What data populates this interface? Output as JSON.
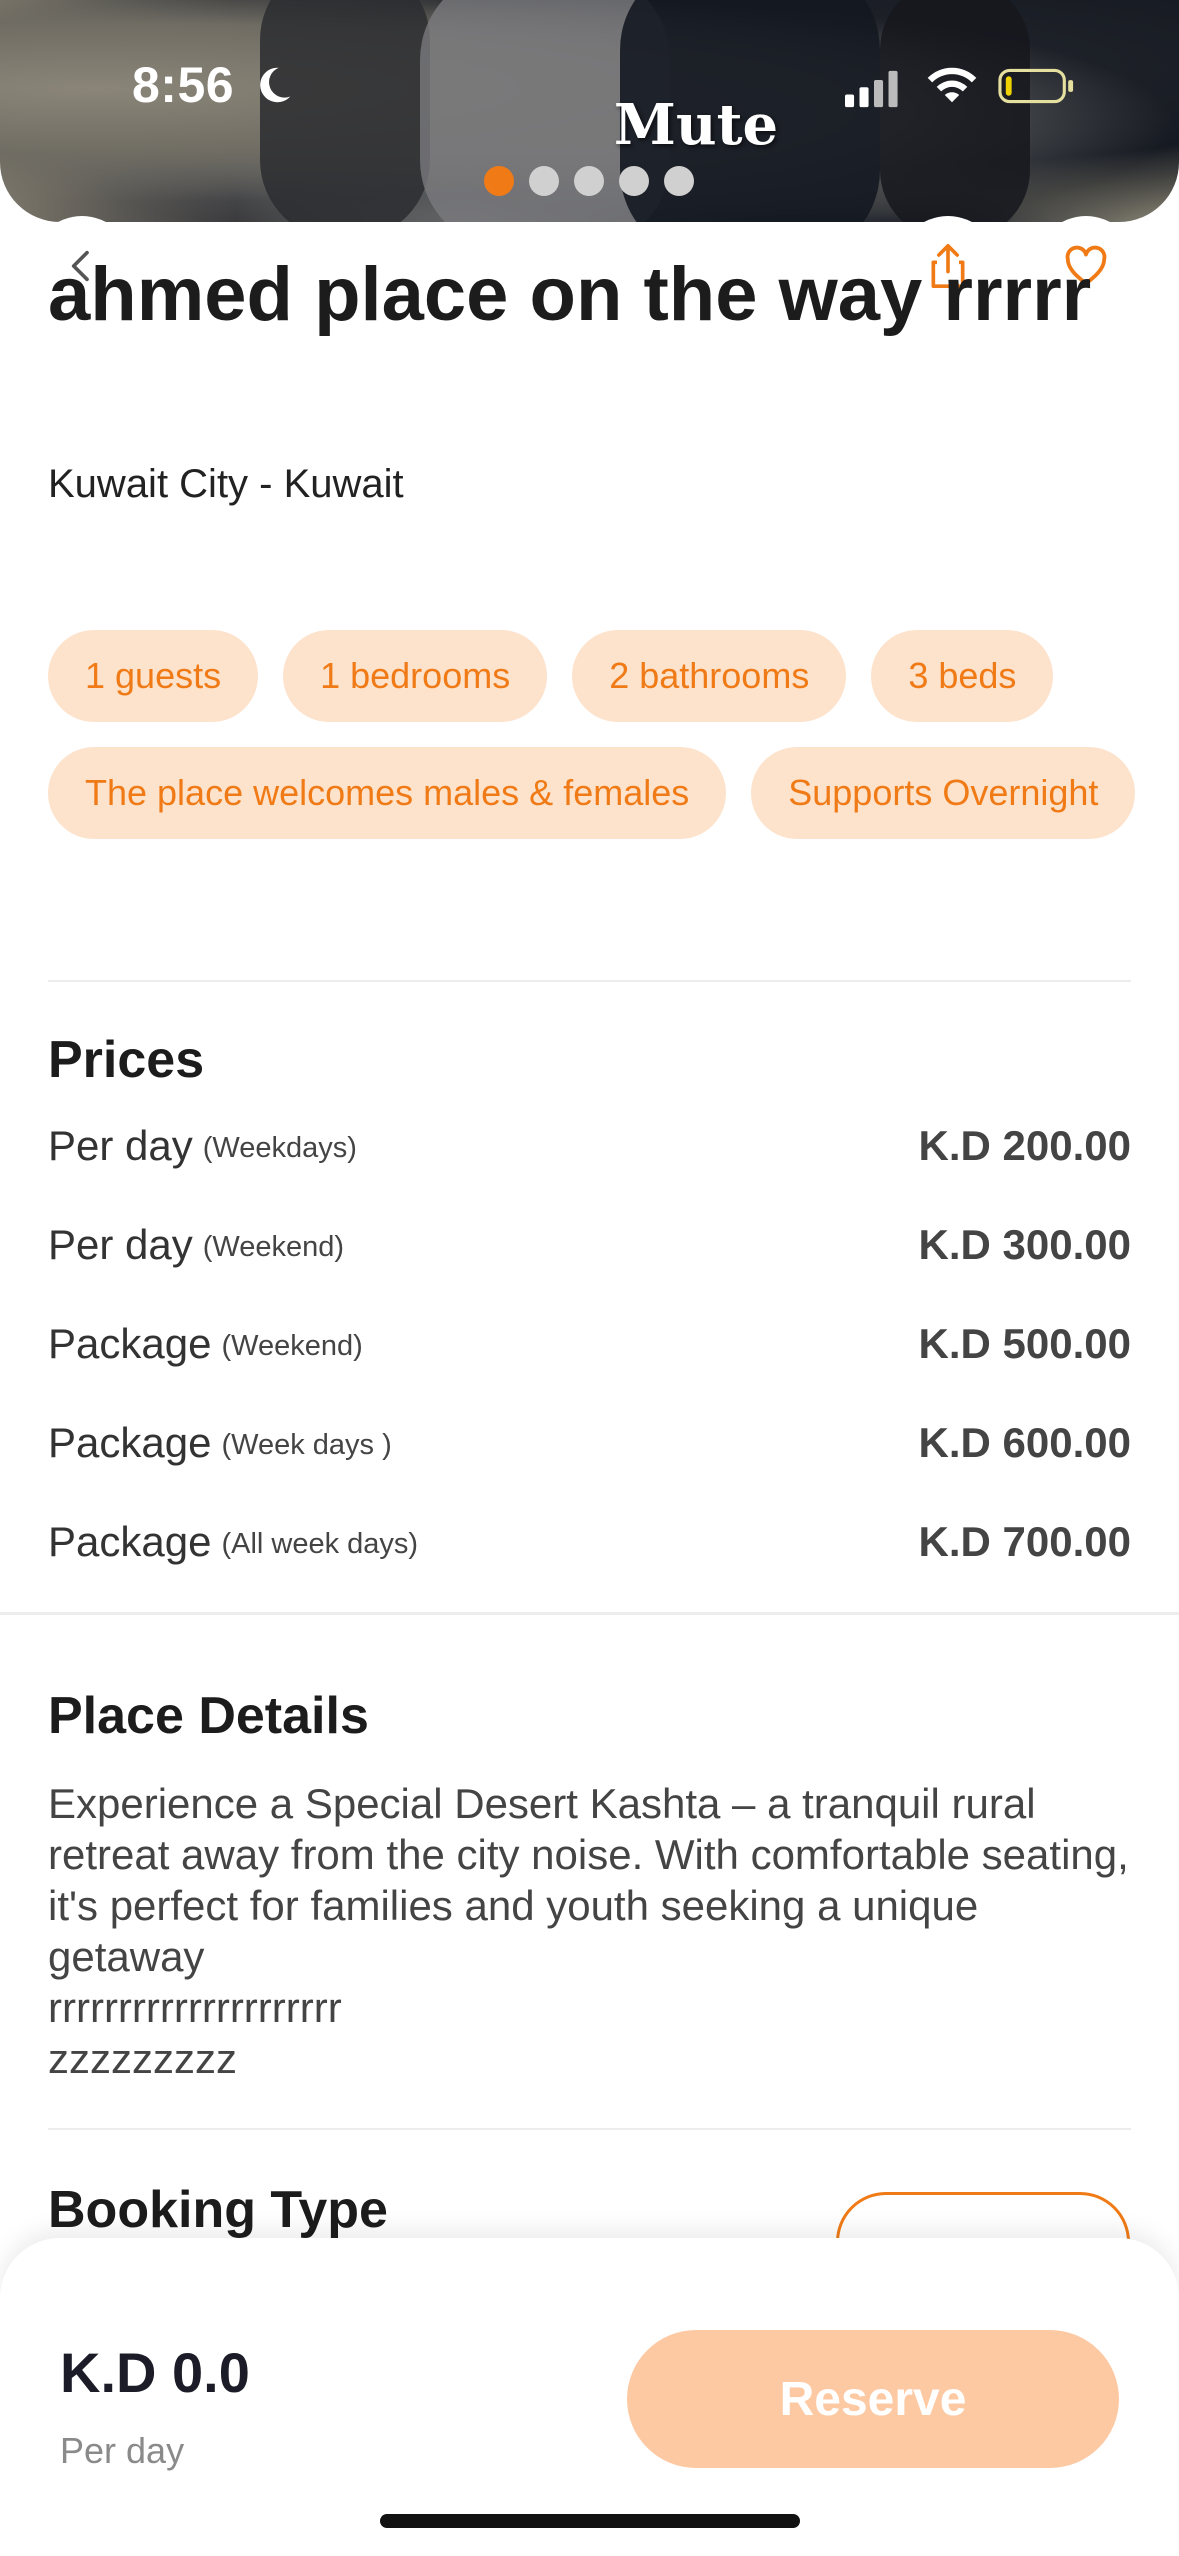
{
  "status_bar": {
    "time": "8:56"
  },
  "hero": {
    "caption": "Mute",
    "dots_count": 5,
    "active_dot": 0
  },
  "header_icons": {
    "back": "chevron-left-icon",
    "share": "share-icon",
    "favorite": "heart-icon"
  },
  "place": {
    "title": "ahmed place on the way rrrrr",
    "location": "Kuwait City - Kuwait"
  },
  "tags": [
    "1 guests",
    "1 bedrooms",
    "2 bathrooms",
    "3 beds",
    "The place welcomes males & females",
    "Supports Overnight"
  ],
  "prices": {
    "title": "Prices",
    "rows": [
      {
        "label": "Per day",
        "sub": "(Weekdays)",
        "value": "K.D 200.00"
      },
      {
        "label": "Per day",
        "sub": "(Weekend)",
        "value": "K.D 300.00"
      },
      {
        "label": "Package",
        "sub": "(Weekend)",
        "value": "K.D 500.00"
      },
      {
        "label": "Package",
        "sub": "(Week days )",
        "value": "K.D 600.00"
      },
      {
        "label": "Package",
        "sub": "(All week days)",
        "value": "K.D 700.00"
      }
    ]
  },
  "details": {
    "title": "Place Details",
    "text": "Experience a Special Desert Kashta – a tranquil rural retreat away from the city noise. With comfortable seating, it's perfect for families and youth seeking a unique getaway\nrrrrrrrrrrrrrrrrrrrrr\nzzzzzzzzz"
  },
  "booking": {
    "title": "Booking Type"
  },
  "bottom_bar": {
    "price": "K.D 0.0",
    "unit": "Per day",
    "reserve_label": "Reserve"
  },
  "colors": {
    "accent": "#f07b16",
    "tag_bg": "#fde2cc",
    "reserve_bg": "#fdc9a3"
  }
}
